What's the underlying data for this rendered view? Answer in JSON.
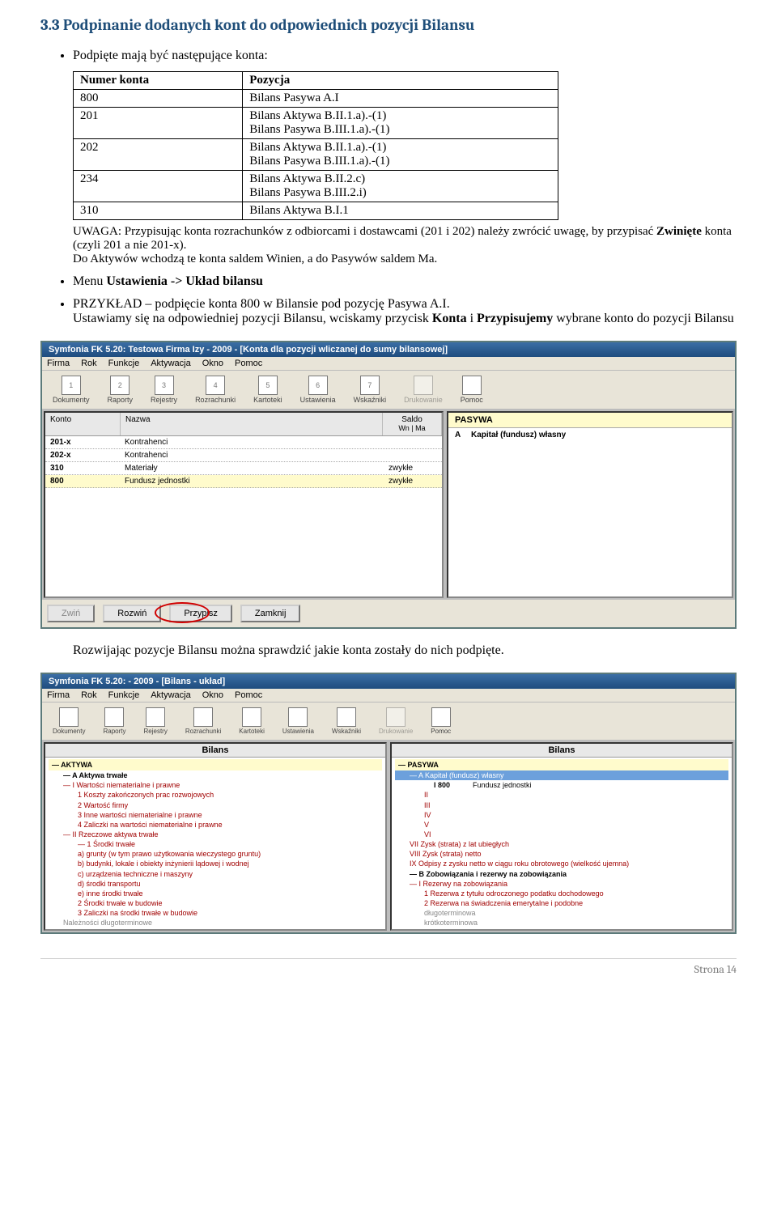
{
  "section_title": "3.3  Podpinanie dodanych kont do odpowiednich pozycji Bilansu",
  "bullet1": "Podpięte mają być następujące konta:",
  "table": {
    "headers": [
      "Numer konta",
      "Pozycja"
    ],
    "rows": [
      [
        "800",
        "Bilans Pasywa A.I"
      ],
      [
        "201",
        "Bilans Aktywa B.II.1.a).-(1)\nBilans Pasywa B.III.1.a).-(1)"
      ],
      [
        "202",
        "Bilans Aktywa B.II.1.a).-(1)\nBilans Pasywa B.III.1.a).-(1)"
      ],
      [
        "234",
        "Bilans Aktywa B.II.2.c)\nBilans Pasywa B.III.2.i)"
      ],
      [
        "310",
        "Bilans Aktywa B.I.1"
      ]
    ]
  },
  "note": {
    "prefix": "UWAGA: Przypisując konta rozrachunków z odbiorcami i dostawcami (201 i 202) należy zwrócić uwagę, by przypisać ",
    "bold1": "Zwinięte",
    "mid": " konta (czyli 201 a nie 201-x).",
    "line2": "Do Aktywów wchodzą te konta saldem Winien, a do Pasywów saldem Ma."
  },
  "bullet2_prefix": "Menu ",
  "bullet2_bold": "Ustawienia -> Układ bilansu",
  "bullet3": {
    "line1": "PRZYKŁAD – podpięcie konta 800 w Bilansie pod pozycję Pasywa A.I.",
    "line2_a": "Ustawiamy się na odpowiedniej pozycji Bilansu, wciskamy przycisk ",
    "line2_b": "Konta",
    "line2_c": " i ",
    "line2_d": "Przypisujemy",
    "line2_e": " wybrane konto do pozycji Bilansu"
  },
  "app1": {
    "title": "Symfonia FK  5.20: Testowa Firma Izy - 2009 - [Konta dla pozycji wliczanej do sumy bilansowej]",
    "menu": [
      "Firma",
      "Rok",
      "Funkcje",
      "Aktywacja",
      "Okno",
      "Pomoc"
    ],
    "toolbar": [
      {
        "num": "1",
        "label": "Dokumenty"
      },
      {
        "num": "2",
        "label": "Raporty"
      },
      {
        "num": "3",
        "label": "Rejestry"
      },
      {
        "num": "4",
        "label": "Rozrachunki"
      },
      {
        "num": "5",
        "label": "Kartoteki"
      },
      {
        "num": "6",
        "label": "Ustawienia"
      },
      {
        "num": "7",
        "label": "Wskaźniki"
      },
      {
        "num": "",
        "label": "Drukowanie",
        "disabled": true
      },
      {
        "num": "",
        "label": "Pomoc"
      }
    ],
    "grid_headers": {
      "konto": "Konto",
      "nazwa": "Nazwa",
      "saldo": "Saldo",
      "wn": "Wn",
      "ma": "Ma"
    },
    "rows": [
      {
        "konto": "201-x",
        "nazwa": "Kontrahenci",
        "saldo": ""
      },
      {
        "konto": "202-x",
        "nazwa": "Kontrahenci",
        "saldo": ""
      },
      {
        "konto": "310",
        "nazwa": "Materiały",
        "saldo": "zwykłe"
      },
      {
        "konto": "800",
        "nazwa": "Fundusz jednostki",
        "saldo": "zwykłe"
      }
    ],
    "right": {
      "header": "PASYWA",
      "row_lbl": "A",
      "row_val": "Kapitał (fundusz) własny"
    },
    "buttons": {
      "zwin": "Zwiń",
      "rozwin": "Rozwiń",
      "przypisz": "Przypisz",
      "zamknij": "Zamknij"
    }
  },
  "post_app1_text": "Rozwijając pozycje Bilansu można sprawdzić jakie konta zostały do nich podpięte.",
  "app2": {
    "title": "Symfonia FK  5.20:                           - 2009 - [Bilans - układ]",
    "menu": [
      "Firma",
      "Rok",
      "Funkcje",
      "Aktywacja",
      "Okno",
      "Pomoc"
    ],
    "toolbar": [
      "Dokumenty",
      "Raporty",
      "Rejestry",
      "Rozrachunki",
      "Kartoteki",
      "Ustawienia",
      "Wskaźniki",
      "Drukowanie",
      "Pomoc"
    ],
    "left": {
      "head": "Bilans",
      "root": "— AKTYWA",
      "lines": [
        {
          "cls": "lvl1 bold2",
          "t": "— A      Aktywa trwałe"
        },
        {
          "cls": "lvl1",
          "t": "— I        Wartości niematerialne i prawne"
        },
        {
          "cls": "lvl2",
          "t": "1   Koszty zakończonych prac rozwojowych"
        },
        {
          "cls": "lvl2",
          "t": "2   Wartość firmy"
        },
        {
          "cls": "lvl2",
          "t": "3   Inne wartości niematerialne i prawne"
        },
        {
          "cls": "lvl2",
          "t": "4   Zaliczki na wartości niematerialne i prawne"
        },
        {
          "cls": "lvl1",
          "t": "— II       Rzeczowe aktywa trwałe"
        },
        {
          "cls": "lvl2",
          "t": "— 1   Środki trwałe"
        },
        {
          "cls": "lvl2",
          "t": "a)  grunty (w tym prawo użytkowania wieczystego gruntu)"
        },
        {
          "cls": "lvl2",
          "t": "b)  budynki, lokale i obiekty inżynierii lądowej i wodnej"
        },
        {
          "cls": "lvl2",
          "t": "c)  urządzenia techniczne i maszyny"
        },
        {
          "cls": "lvl2",
          "t": "d)  środki transportu"
        },
        {
          "cls": "lvl2",
          "t": "e)  inne środki trwałe"
        },
        {
          "cls": "lvl2",
          "t": "2   Środki trwałe w budowie"
        },
        {
          "cls": "lvl2",
          "t": "3   Zaliczki na środki trwałe w budowie"
        },
        {
          "cls": "lvl1 grey",
          "t": "Należności długoterminowe"
        }
      ]
    },
    "right": {
      "head": "Bilans",
      "root": "— PASYWA",
      "lines": [
        {
          "cls": "lvl1 hl",
          "t": "— A      Kapitał (fundusz) własny"
        },
        {
          "cls": "konto-row",
          "kn": "I   800",
          "t": "Fundusz jednostki"
        },
        {
          "cls": "lvl2",
          "t": "II"
        },
        {
          "cls": "lvl2",
          "t": "III"
        },
        {
          "cls": "lvl2",
          "t": "IV"
        },
        {
          "cls": "lvl2",
          "t": "V"
        },
        {
          "cls": "lvl2",
          "t": "VI"
        },
        {
          "cls": "lvl1",
          "t": "VII      Zysk (strata) z lat ubiegłych"
        },
        {
          "cls": "lvl1",
          "t": "VIII     Zysk (strata) netto"
        },
        {
          "cls": "lvl1",
          "t": "IX       Odpisy z zysku netto w ciągu roku obrotowego (wielkość ujemna)"
        },
        {
          "cls": "lvl1 bold2",
          "t": "— B      Zobowiązania i rezerwy na zobowiązania"
        },
        {
          "cls": "lvl1",
          "t": "— I        Rezerwy na zobowiązania"
        },
        {
          "cls": "lvl2",
          "t": "1   Rezerwa z tytułu odroczonego podatku dochodowego"
        },
        {
          "cls": "lvl2",
          "t": "2   Rezerwa na świadczenia emerytalne i podobne"
        },
        {
          "cls": "lvl2 grey",
          "t": "    długoterminowa"
        },
        {
          "cls": "lvl2 grey",
          "t": "    krótkoterminowa"
        }
      ]
    }
  },
  "footer": "Strona 14"
}
